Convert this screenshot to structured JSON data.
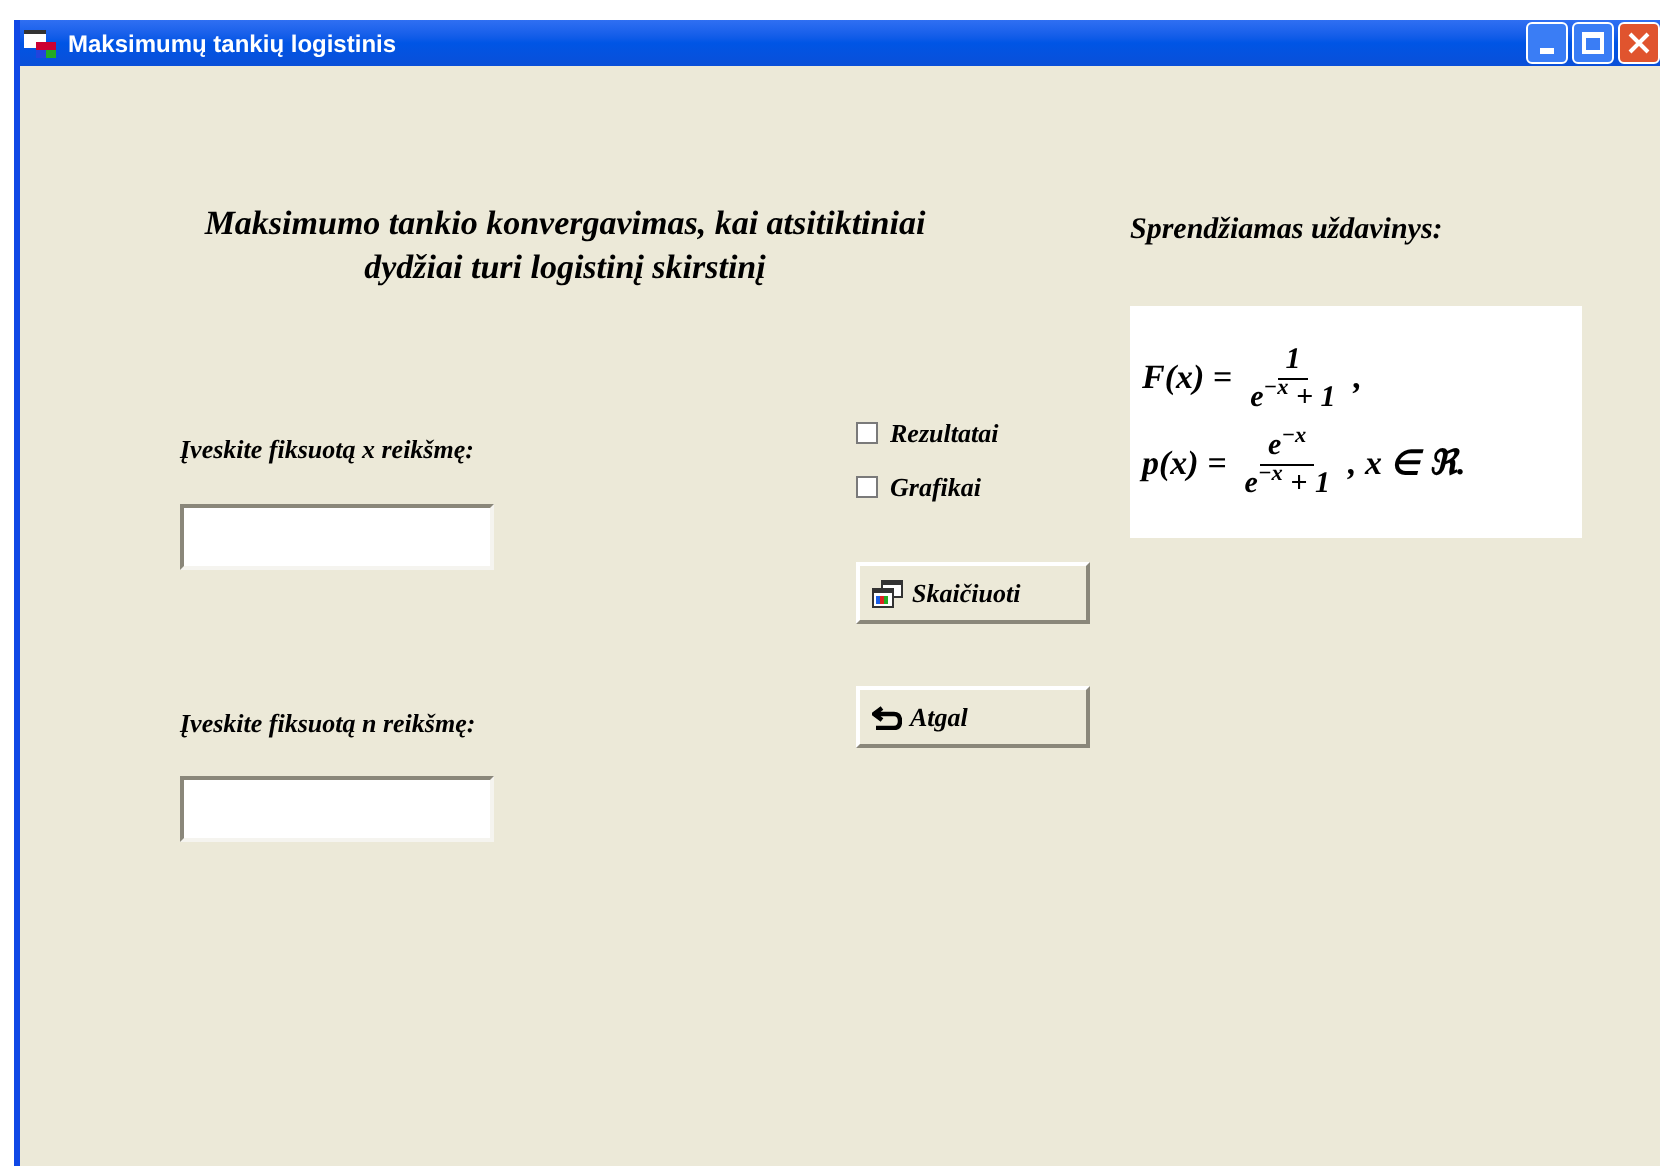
{
  "window": {
    "title": "Maksimumų tankių logistinis"
  },
  "heading": "Maksimumo tankio konvergavimas, kai atsitiktiniai dydžiai turi logistinį skirstinį",
  "problem_title": "Sprendžiamas uždavinys:",
  "formulas": [
    {
      "lhs": "F(x) =",
      "numerator": "1",
      "denominator": "e$^{−x}$ + 1",
      "tail": ","
    },
    {
      "lhs": "p(x) =",
      "numerator": "e$^{−x}$",
      "denominator": "e$^{−x}$ + 1",
      "tail": ", x ∈ ℜ."
    }
  ],
  "fields": [
    {
      "label": "Įveskite fiksuotą x reikšmę:"
    },
    {
      "label": "Įveskite fiksuotą n reikšmę:"
    }
  ],
  "checkboxes": [
    {
      "label": "Rezultatai",
      "checked": false
    },
    {
      "label": "Grafikai",
      "checked": false
    }
  ],
  "buttons": [
    {
      "label": "Skaičiuoti",
      "kind": "calculate"
    },
    {
      "label": "Atgal",
      "kind": "back"
    }
  ]
}
